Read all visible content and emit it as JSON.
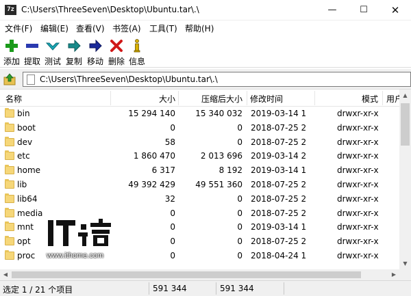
{
  "window": {
    "app_icon_text": "7z",
    "title": "C:\\Users\\ThreeSeven\\Desktop\\Ubuntu.tar\\.\\",
    "minimize_glyph": "—",
    "maximize_glyph": "☐",
    "close_glyph": "✕"
  },
  "menu": [
    "文件(F)",
    "编辑(E)",
    "查看(V)",
    "书签(A)",
    "工具(T)",
    "帮助(H)"
  ],
  "toolbar": [
    {
      "label": "添加",
      "icon": "add-icon",
      "color": "#1a9a1a"
    },
    {
      "label": "提取",
      "icon": "extract-icon",
      "color": "#2a3ab0"
    },
    {
      "label": "测试",
      "icon": "test-icon",
      "color": "#1aa7b5"
    },
    {
      "label": "复制",
      "icon": "copy-icon",
      "color": "#178a8a"
    },
    {
      "label": "移动",
      "icon": "move-icon",
      "color": "#1a2a9a"
    },
    {
      "label": "删除",
      "icon": "delete-icon",
      "color": "#d01818"
    },
    {
      "label": "信息",
      "icon": "info-icon",
      "color": "#d8b000"
    }
  ],
  "path": {
    "value": "C:\\Users\\ThreeSeven\\Desktop\\Ubuntu.tar\\.\\"
  },
  "columns": {
    "name": "名称",
    "size": "大小",
    "packed": "压缩后大小",
    "modified": "修改时间",
    "mode": "模式",
    "extra": "用户"
  },
  "rows": [
    {
      "name": "bin",
      "size": "15 294 140",
      "packed": "15 340 032",
      "modified": "2019-03-14 1",
      "mode": "drwxr-xr-x"
    },
    {
      "name": "boot",
      "size": "0",
      "packed": "0",
      "modified": "2018-07-25 2",
      "mode": "drwxr-xr-x"
    },
    {
      "name": "dev",
      "size": "58",
      "packed": "0",
      "modified": "2018-07-25 2",
      "mode": "drwxr-xr-x"
    },
    {
      "name": "etc",
      "size": "1 860 470",
      "packed": "2 013 696",
      "modified": "2019-03-14 2",
      "mode": "drwxr-xr-x"
    },
    {
      "name": "home",
      "size": "6 317",
      "packed": "8 192",
      "modified": "2019-03-14 1",
      "mode": "drwxr-xr-x"
    },
    {
      "name": "lib",
      "size": "49 392 429",
      "packed": "49 551 360",
      "modified": "2018-07-25 2",
      "mode": "drwxr-xr-x"
    },
    {
      "name": "lib64",
      "size": "32",
      "packed": "0",
      "modified": "2018-07-25 2",
      "mode": "drwxr-xr-x"
    },
    {
      "name": "media",
      "size": "0",
      "packed": "0",
      "modified": "2018-07-25 2",
      "mode": "drwxr-xr-x"
    },
    {
      "name": "mnt",
      "size": "0",
      "packed": "0",
      "modified": "2019-03-14 1",
      "mode": "drwxr-xr-x"
    },
    {
      "name": "opt",
      "size": "0",
      "packed": "0",
      "modified": "2018-07-25 2",
      "mode": "drwxr-xr-x"
    },
    {
      "name": "proc",
      "size": "0",
      "packed": "0",
      "modified": "2018-04-24 1",
      "mode": "drwxr-xr-x"
    }
  ],
  "status": {
    "selection": "选定 1 / 21 个项目",
    "size": "591 344",
    "packed": "591 344"
  },
  "watermark": {
    "logo_text": "IT之家",
    "url": "www.ithome.com"
  }
}
